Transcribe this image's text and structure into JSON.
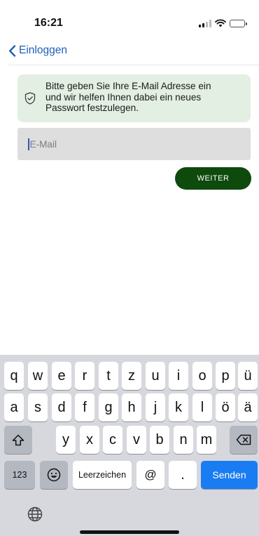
{
  "status_bar": {
    "time": "16:21",
    "icons": [
      "signal-icon",
      "wifi-icon",
      "battery-icon"
    ]
  },
  "nav": {
    "back_label": "Einloggen",
    "back_icon": "chevron-left-icon"
  },
  "info_box": {
    "icon": "shield-check-icon",
    "lines": [
      "Bitte geben Sie Ihre E-Mail Adresse ein",
      "und wir helfen Ihnen dabei ein neues",
      "Passwort festzulegen."
    ]
  },
  "email_field": {
    "value": "",
    "placeholder": "E-Mail"
  },
  "weiter_button": {
    "label": "WEITER"
  },
  "keyboard": {
    "row1": [
      "q",
      "w",
      "e",
      "r",
      "t",
      "z",
      "u",
      "i",
      "o",
      "p",
      "ü"
    ],
    "row2": [
      "a",
      "s",
      "d",
      "f",
      "g",
      "h",
      "j",
      "k",
      "l",
      "ö",
      "ä"
    ],
    "row3": [
      "y",
      "x",
      "c",
      "v",
      "b",
      "n",
      "m"
    ],
    "numbers_label": "123",
    "emoji_icon": "emoji-icon",
    "space_label": "Leerzeichen",
    "at_label": "@",
    "dot_label": ".",
    "send_label": "Senden",
    "shift_icon": "shift-icon",
    "delete_icon": "backspace-icon",
    "globe_icon": "globe-icon"
  },
  "colors": {
    "accent_link": "#1f5fb8",
    "button_green": "#0e4a0e",
    "info_background": "#e3efe2",
    "send_key_blue": "#1a7cf3"
  }
}
